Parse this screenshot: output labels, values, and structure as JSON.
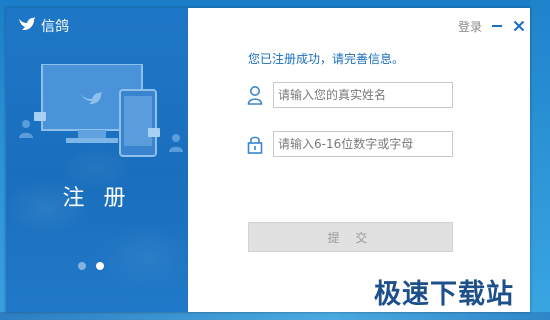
{
  "app": {
    "name": "信鸽",
    "panel_title": "注 册",
    "slides": [
      {
        "active": false
      },
      {
        "active": true
      }
    ]
  },
  "titlebar": {
    "login_label": "登录",
    "minimize_icon": "minimize-icon",
    "close_icon": "close-icon"
  },
  "form": {
    "success_message": "您已注册成功，请完善信息。",
    "name_field": {
      "value": "",
      "placeholder": "请输入您的真实姓名",
      "icon": "user-icon"
    },
    "password_field": {
      "value": "",
      "placeholder": "请输入6-16位数字或字母",
      "icon": "lock-icon"
    },
    "submit_label": "提 交"
  },
  "watermark": "极速下载站",
  "colors": {
    "panel_blue": "#1a6fbd",
    "accent_text": "#1a6fbd",
    "button_disabled": "#e1e1e1"
  }
}
